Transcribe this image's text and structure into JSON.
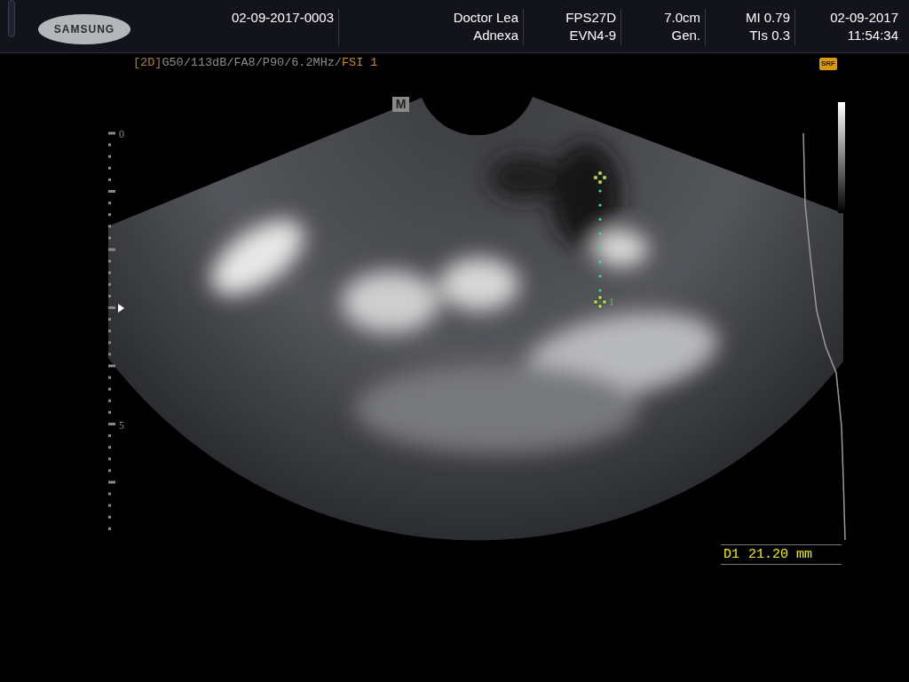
{
  "header": {
    "logo": "SAMSUNG",
    "exam_id": "02-09-2017-0003",
    "info": [
      {
        "line1": "Doctor Lea",
        "line2": "Adnexa"
      },
      {
        "line1": "FPS27D",
        "line2": "EVN4-9"
      },
      {
        "line1": "7.0cm",
        "line2": "Gen."
      },
      {
        "line1": "MI 0.79",
        "line2": "TIs 0.3"
      },
      {
        "line1": "02-09-2017",
        "line2": "11:54:34"
      }
    ]
  },
  "imaging_params": {
    "mode": "[2D]",
    "settings": "G50/113dB/FA8/P90/6.2MHz/",
    "preset": "FSI 1"
  },
  "srf_badge": "SRF",
  "image": {
    "orientation_marker": "M",
    "depth_labels": [
      {
        "depth": "0",
        "kind": "major"
      },
      {
        "depth": "5",
        "kind": "major"
      }
    ],
    "caliper_label": "1"
  },
  "measurement": {
    "label": "D1",
    "value": "21.20 mm"
  }
}
